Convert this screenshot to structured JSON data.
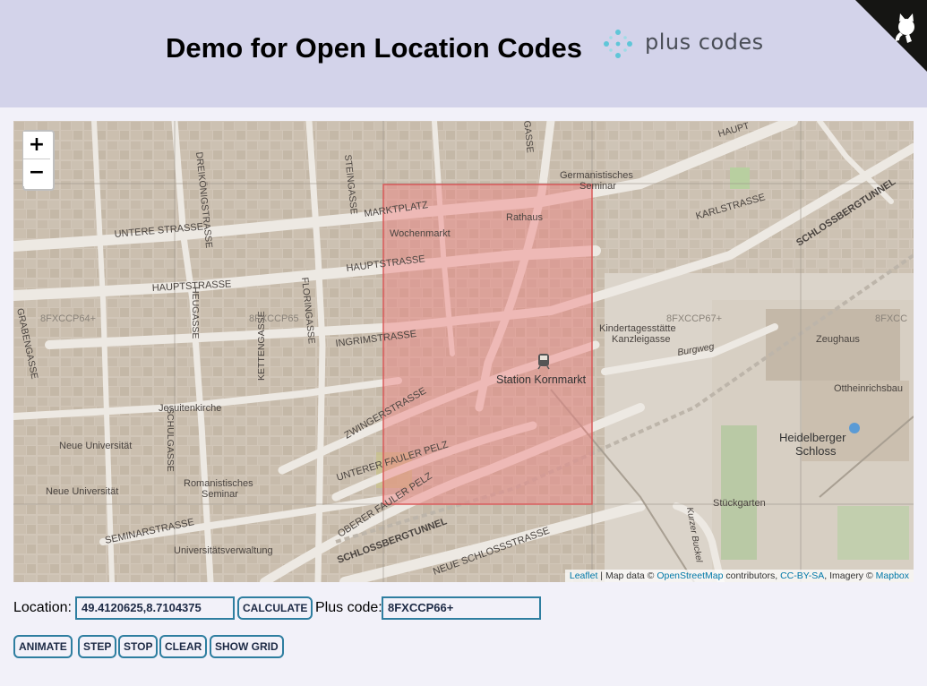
{
  "header": {
    "title": "Demo for Open Location Codes",
    "logo_text": "plus codes"
  },
  "map": {
    "zoom_in": "+",
    "zoom_out": "−",
    "streets": {
      "marktplatz": "MARKTPLATZ",
      "untere_strasse": "UNTERE STRASSE",
      "hauptstrasse": "HAUPTSTRASSE",
      "hauptstrasse_west": "HAUPTSTRASSE",
      "ingrimstrasse": "INGRIMSTRASSE",
      "zwingerstrasse": "ZWINGERSTRASSE",
      "unterer_fauler_pelz": "UNTERER FAULER PELZ",
      "oberer_fauler_pelz": "OBERER FAULER PELZ",
      "schlossbergtunnel": "SCHLOSSBERGTUNNEL",
      "schlossbergtunnel_ne": "SCHLOSSBERGTUNNEL",
      "seminarstrasse": "SEMINARSTRASSE",
      "neue_schlossstrasse": "NEUE SCHLOSSSTRASSE",
      "karlstrasse": "KARLSTRASSE",
      "burgweg": "Burgweg",
      "kurzer_buckel": "Kurzer Buckel",
      "grabengasse": "GRABENGASSE",
      "heugasse": "HEUGASSE",
      "floringasse": "FLORINGASSE",
      "kettengasse": "KETTENGASSE",
      "schulgasse": "SCHULGASSE",
      "steingasse": "STEINGASSE",
      "dreikoenigstrasse": "DREIKÖNIGSTRASSE",
      "gasse": "GASSE",
      "haupt_ne": "HAUPT"
    },
    "places": {
      "germanistisches": "Germanistisches",
      "seminar_top": "Seminar",
      "rathaus": "Rathaus",
      "wochenmarkt": "Wochenmarkt",
      "kindergarten_1": "Kindertagesstätte",
      "kindergarten_2": "Kanzleigasse",
      "station": "Station Kornmarkt",
      "zeughaus": "Zeughaus",
      "ottheinrichsbau": "Ottheinrichsbau",
      "schloss_1": "Heidelberger",
      "schloss_2": "Schloss",
      "jesuitenkirche": "Jesuitenkirche",
      "neue_uni_1": "Neue Universität",
      "neue_uni_2": "Neue Universität",
      "romanistisches": "Romanistisches",
      "seminar_bottom": "Seminar",
      "universitaetsverwaltung": "Universitätsverwaltung",
      "stueckgarten": "Stückgarten"
    },
    "grid_codes": {
      "c64": "8FXCCP64+",
      "c65": "8FXCCP65",
      "c67": "8FXCCP67+",
      "c68": "8FXCC"
    },
    "attribution": {
      "leaflet": "Leaflet",
      "map_data": " | Map data © ",
      "osm": "OpenStreetMap",
      "contributors": " contributors, ",
      "license": "CC-BY-SA",
      "imagery": ", Imagery © ",
      "mapbox": "Mapbox"
    },
    "highlight_color": "#e8877f"
  },
  "controls": {
    "location_label": "Location:",
    "location_value": "49.4120625,8.7104375",
    "calculate_label": "CALCULATE",
    "pluscode_label": "Plus code:",
    "pluscode_value": "8FXCCP66+",
    "animate_label": "ANIMATE",
    "step_label": "STEP",
    "stop_label": "STOP",
    "clear_label": "CLEAR",
    "show_grid_label": "SHOW GRID"
  },
  "colors": {
    "header_bg": "#d3d3ea",
    "page_bg": "#f2f1f9",
    "button_border": "#2e7ea0",
    "link": "#0078a8"
  }
}
